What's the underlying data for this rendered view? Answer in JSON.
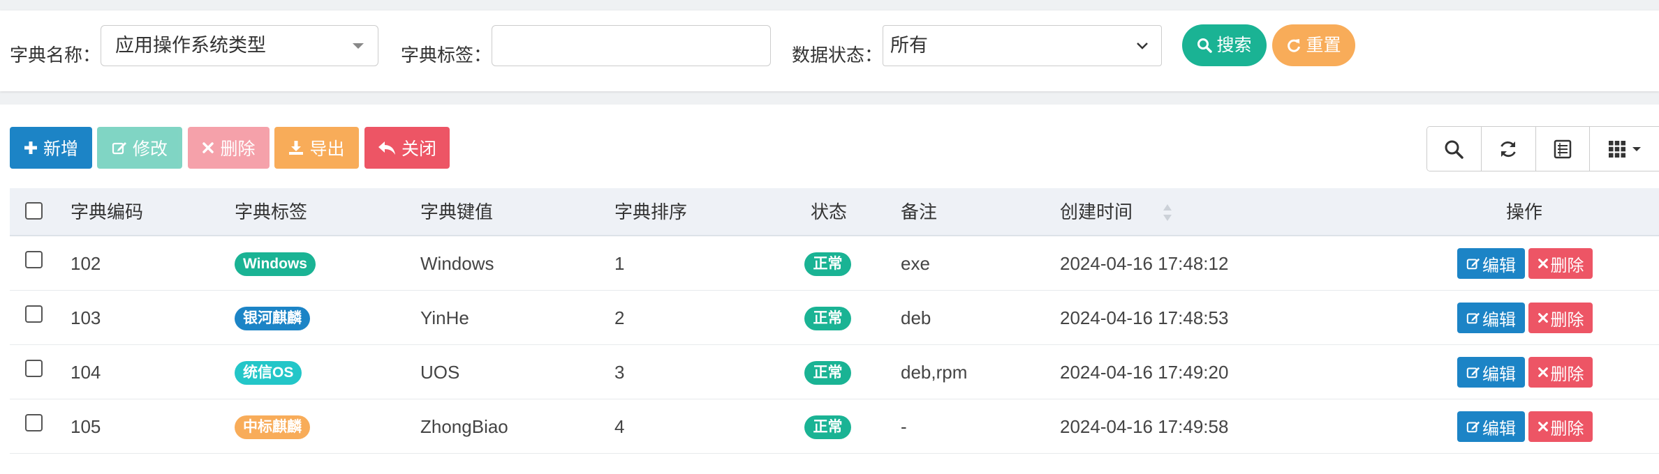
{
  "search": {
    "dict_name_label": "字典名称：",
    "dict_name_value": "应用操作系统类型",
    "dict_label_label": "字典标签：",
    "dict_label_value": "",
    "status_label": "数据状态：",
    "status_value": "所有",
    "search_button": "搜索",
    "reset_button": "重置"
  },
  "toolbar": {
    "add": "新增",
    "edit": "修改",
    "delete": "删除",
    "export": "导出",
    "close": "关闭"
  },
  "table": {
    "headers": {
      "code": "字典编码",
      "label": "字典标签",
      "value": "字典键值",
      "sort": "字典排序",
      "status": "状态",
      "remark": "备注",
      "created": "创建时间",
      "actions": "操作"
    },
    "action_labels": {
      "edit": "编辑",
      "delete": "删除"
    },
    "rows": [
      {
        "code": "102",
        "label": "Windows",
        "label_color": "#1ab394",
        "value": "Windows",
        "sort": "1",
        "status": "正常",
        "remark": "exe",
        "created": "2024-04-16 17:48:12"
      },
      {
        "code": "103",
        "label": "银河麒麟",
        "label_color": "#1c84c6",
        "value": "YinHe",
        "sort": "2",
        "status": "正常",
        "remark": "deb",
        "created": "2024-04-16 17:48:53"
      },
      {
        "code": "104",
        "label": "统信OS",
        "label_color": "#23c6c8",
        "value": "UOS",
        "sort": "3",
        "status": "正常",
        "remark": "deb,rpm",
        "created": "2024-04-16 17:49:20"
      },
      {
        "code": "105",
        "label": "中标麒麟",
        "label_color": "#f8ac59",
        "value": "ZhongBiao",
        "sort": "4",
        "status": "正常",
        "remark": "-",
        "created": "2024-04-16 17:49:58"
      }
    ]
  },
  "colors": {
    "primary": "#1c84c6",
    "success": "#1ab394",
    "warning": "#f8ac59",
    "danger": "#ed5565",
    "info": "#23c6c8"
  },
  "icons": [
    "plus-icon",
    "edit-icon",
    "remove-icon",
    "download-icon",
    "reply-icon",
    "search-icon",
    "refresh-icon",
    "list-icon",
    "grid-icon",
    "caret-down-icon",
    "sort-icon",
    "chevron-down-icon"
  ]
}
